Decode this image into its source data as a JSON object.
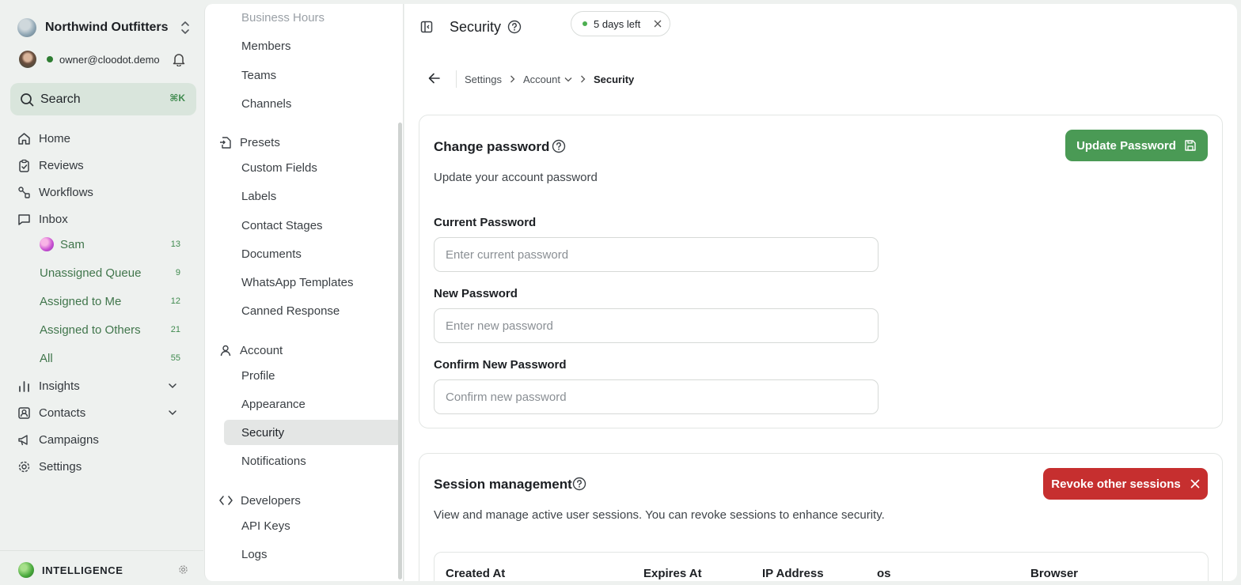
{
  "sidebar": {
    "org_name": "Northwind Outfitters",
    "user_email": "owner@cloodot.demo",
    "search_label": "Search",
    "search_shortcut": "⌘K",
    "nav": {
      "home": "Home",
      "reviews": "Reviews",
      "workflows": "Workflows",
      "inbox": "Inbox",
      "insights": "Insights",
      "contacts": "Contacts",
      "campaigns": "Campaigns",
      "settings": "Settings"
    },
    "inbox_items": [
      {
        "label": "Sam",
        "count": "13"
      },
      {
        "label": "Unassigned Queue",
        "count": "9"
      },
      {
        "label": "Assigned to Me",
        "count": "12"
      },
      {
        "label": "Assigned to Others",
        "count": "21"
      },
      {
        "label": "All",
        "count": "55"
      }
    ],
    "intelligence_label": "INTELLIGENCE"
  },
  "settings_nav": {
    "items_top": [
      "Business Hours",
      "Members",
      "Teams",
      "Channels"
    ],
    "presets": {
      "label": "Presets",
      "items": [
        "Custom Fields",
        "Labels",
        "Contact Stages",
        "Documents",
        "WhatsApp Templates",
        "Canned Response"
      ]
    },
    "account": {
      "label": "Account",
      "items": [
        "Profile",
        "Appearance",
        "Security",
        "Notifications"
      ]
    },
    "developers": {
      "label": "Developers",
      "items": [
        "API Keys",
        "Logs"
      ]
    }
  },
  "header": {
    "title": "Security",
    "trial_text": "5 days left"
  },
  "breadcrumb": {
    "items": [
      "Settings",
      "Account",
      "Security"
    ]
  },
  "password_card": {
    "title": "Change password",
    "description": "Update your account password",
    "update_button": "Update Password",
    "fields": [
      {
        "label": "Current Password",
        "placeholder": "Enter current password"
      },
      {
        "label": "New Password",
        "placeholder": "Enter new password"
      },
      {
        "label": "Confirm New Password",
        "placeholder": "Confirm new password"
      }
    ]
  },
  "sessions_card": {
    "title": "Session management",
    "description": "View and manage active user sessions. You can revoke sessions to enhance security.",
    "revoke_button": "Revoke other sessions",
    "columns": [
      "Created At",
      "Expires At",
      "IP Address",
      "os",
      "Browser"
    ]
  },
  "colors": {
    "accent_green": "#4a9a55",
    "danger_red": "#c62f2f",
    "sidebar_bg": "#eef1ef"
  }
}
